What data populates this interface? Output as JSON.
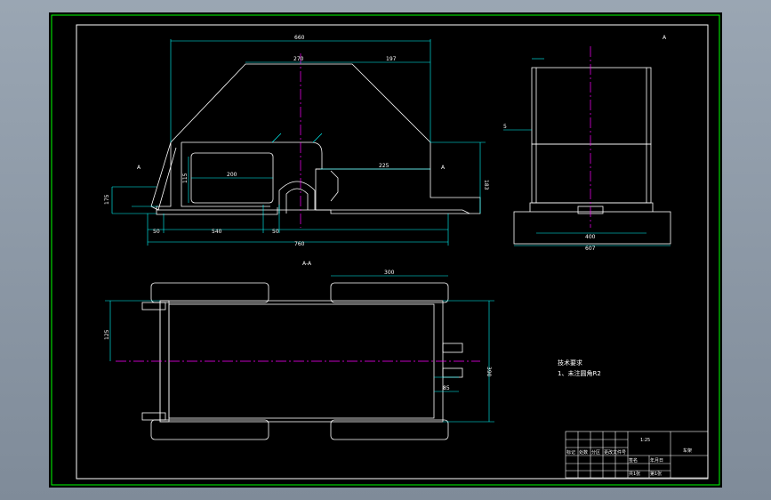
{
  "colors": {
    "background": "#000000",
    "border": "#00ff00",
    "outline": "#ffffff",
    "dimension": "#00ffff",
    "centerline": "#ff00ff",
    "titleblock_label": "#00ff00"
  },
  "front_view": {
    "dims": {
      "overall_top": "660",
      "top_mid": "270",
      "top_right": "197",
      "window_width": "200",
      "right_span": "225",
      "height_right": "183",
      "base_left": "50",
      "base_mid": "540",
      "base_small": "50",
      "overall_base": "760",
      "left_height": "175",
      "window_h": "115"
    },
    "section_marks": [
      "A",
      "A"
    ]
  },
  "side_view": {
    "title": "A",
    "dims": {
      "base_inner": "400",
      "base_outer": "607"
    },
    "marks": [
      "5"
    ]
  },
  "top_view": {
    "label": "A-A",
    "dims": {
      "right_top": "300",
      "height": "390",
      "left_offset": "125",
      "small": "85"
    }
  },
  "notes": {
    "heading": "技术要求",
    "line1": "1、未注圆角R2"
  },
  "title_block": {
    "scale": "1:25",
    "drawing_name": "车架",
    "rows": [
      "标记",
      "处数",
      "分区",
      "更改文件号",
      "签名",
      "年月日"
    ],
    "footer": [
      "共1张",
      "第1张"
    ]
  }
}
